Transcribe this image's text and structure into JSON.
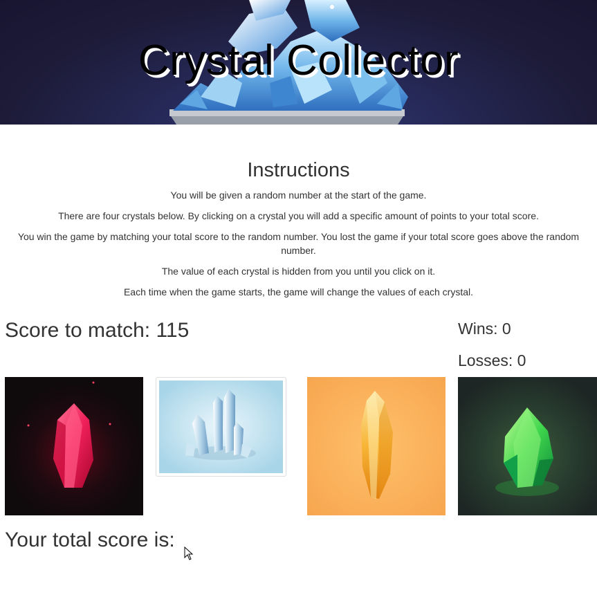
{
  "header": {
    "title": "Crystal Collector"
  },
  "instructions": {
    "heading": "Instructions",
    "lines": [
      "You will be given a random number at the start of the game.",
      "There are four crystals below. By clicking on a crystal you will add a specific amount of points to your total score.",
      "You win the game by matching your total score to the random number. You lost the game if your total score goes above the random number.",
      "The value of each crystal is hidden from you until you click on it.",
      "Each time when the game starts, the game will change the values of each crystal."
    ]
  },
  "score": {
    "match_label": "Score to match:",
    "match_value": "115",
    "wins_label": "Wins:",
    "wins_value": "0",
    "losses_label": "Losses:",
    "losses_value": "0",
    "total_label": "Your total score is:",
    "total_value": ""
  },
  "crystals": [
    {
      "name": "red-crystal",
      "color": "#e8194f"
    },
    {
      "name": "blue-crystal",
      "color": "#a9d6ea"
    },
    {
      "name": "orange-crystal",
      "color": "#f7a64f"
    },
    {
      "name": "green-crystal",
      "color": "#3fd64c"
    }
  ],
  "theme": {
    "banner_bg": "#1d1b38",
    "text": "#333333"
  }
}
